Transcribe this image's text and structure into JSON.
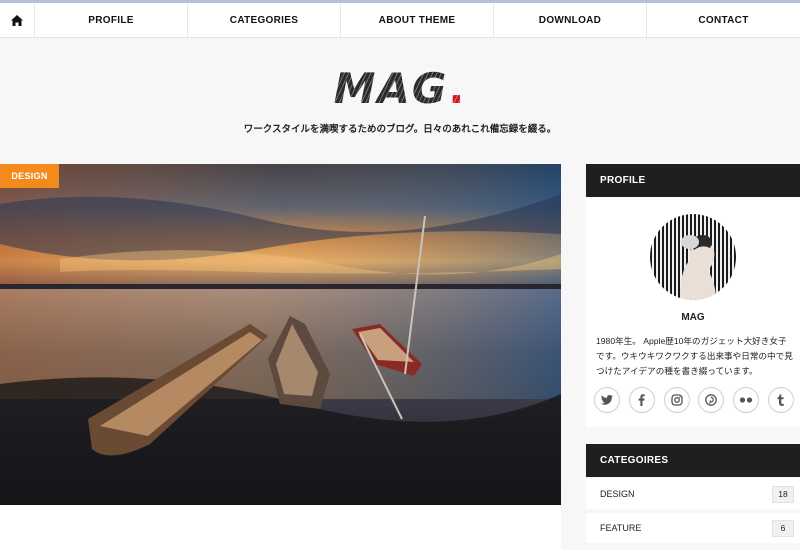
{
  "nav": {
    "home_icon": "home-icon",
    "items": [
      "PROFILE",
      "CATEGORIES",
      "ABOUT THEME",
      "DOWNLOAD",
      "CONTACT"
    ]
  },
  "header": {
    "logo_text": "MAG",
    "logo_dot": ".",
    "tagline": "ワークスタイルを満喫するためのブログ。日々のあれこれ備忘録を綴る。"
  },
  "featured": {
    "category_badge": "DESIGN",
    "image_subject": "three wooden boats on a lake at sunset"
  },
  "sidebar": {
    "profile": {
      "heading": "PROFILE",
      "name": "MAG",
      "bio": "1980年生。 Apple歴10年のガジェット大好き女子です。ウキウキワクワクする出来事や日常の中で見つけたアイデアの種を書き綴っています。",
      "socials": [
        {
          "icon": "twitter-icon",
          "glyph": "t"
        },
        {
          "icon": "facebook-icon",
          "glyph": "f"
        },
        {
          "icon": "instagram-icon",
          "glyph": "◎"
        },
        {
          "icon": "pinterest-icon",
          "glyph": "p"
        },
        {
          "icon": "flickr-icon",
          "glyph": "●●"
        },
        {
          "icon": "tumblr-icon",
          "glyph": "t"
        }
      ]
    },
    "categories": {
      "heading": "CATEGOIRES",
      "items": [
        {
          "label": "DESIGN",
          "count": "18"
        },
        {
          "label": "FEATURE",
          "count": "6"
        }
      ]
    }
  },
  "colors": {
    "accent": "#f28a1c",
    "logo_dot": "#d0191f",
    "widget_header": "#1f1f1f"
  }
}
